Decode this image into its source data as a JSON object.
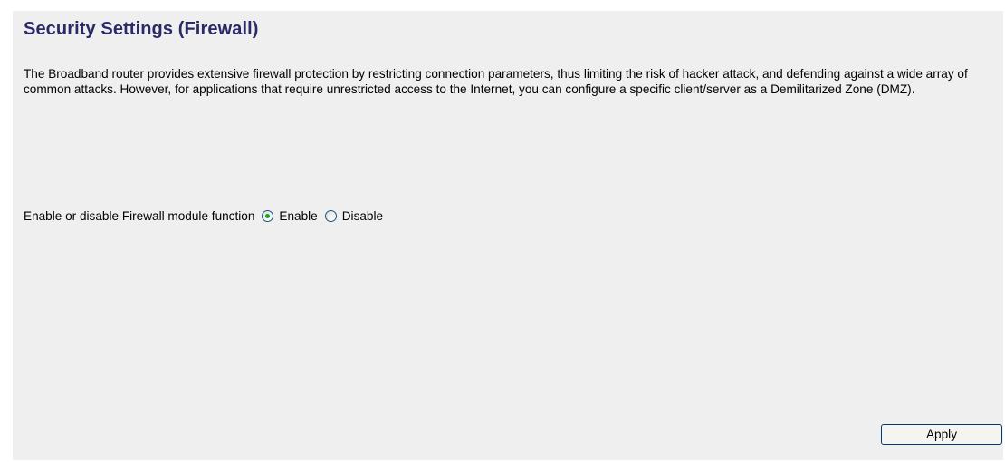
{
  "page": {
    "title": "Security Settings (Firewall)",
    "description": "The Broadband router provides extensive firewall protection by restricting connection parameters, thus limiting the risk of hacker attack, and defending against a wide array of common attacks. However, for applications that require unrestricted access to the Internet, you can configure a specific client/server as a Demilitarized Zone (DMZ)."
  },
  "firewall": {
    "label": "Enable or disable Firewall module function",
    "options": [
      {
        "label": "Enable",
        "selected": true
      },
      {
        "label": "Disable",
        "selected": false
      }
    ]
  },
  "actions": {
    "apply_label": "Apply"
  },
  "colors": {
    "title": "#2a2a66",
    "panel_background": "#efefef",
    "radio_selected_dot": "#21a121",
    "button_border": "#003c74"
  }
}
